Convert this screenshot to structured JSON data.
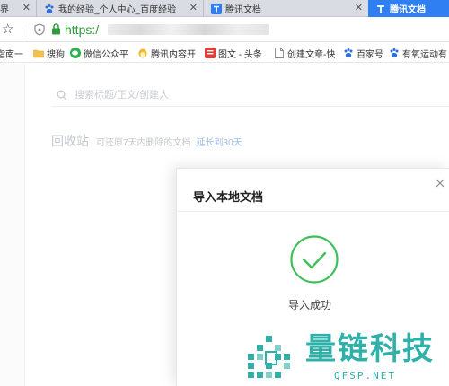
{
  "browser": {
    "tabs": [
      {
        "label": "界",
        "icon": "none",
        "close": "✕"
      },
      {
        "label": "我的经验_个人中心_百度经验",
        "icon": "baidu-paw-icon",
        "close": "✕"
      },
      {
        "label": "腾讯文档",
        "icon": "tencent-docs-icon",
        "close": "✕"
      },
      {
        "label": "腾讯文档",
        "icon": "tencent-docs-icon",
        "close": ""
      }
    ],
    "address": {
      "star": "☆",
      "url": "https:/"
    },
    "bookmarks": [
      {
        "label": "指南一",
        "icon": "none"
      },
      {
        "label": "搜狗",
        "icon": "folder-icon"
      },
      {
        "label": "微信公众平",
        "icon": "wechat-icon"
      },
      {
        "label": "腾讯内容开",
        "icon": "tencent-penguin-icon"
      },
      {
        "label": "图文 - 头条",
        "icon": "toutiao-icon"
      },
      {
        "label": "创建文章-快",
        "icon": "page-icon"
      },
      {
        "label": "百家号",
        "icon": "baidu-paw-icon"
      },
      {
        "label": "有氧运动有",
        "icon": "baidu-paw-icon"
      }
    ]
  },
  "page": {
    "search": {
      "placeholder": "搜索标题/正文/创建人"
    },
    "recycle": {
      "title": "回收站",
      "hint": "可还原7天内删除的文档",
      "link": "延长到30天"
    }
  },
  "dialog": {
    "title": "导入本地文档",
    "status": "导入成功",
    "close": "×"
  },
  "watermark": {
    "brand": "量链科技",
    "site": "QFSP.NET"
  },
  "colors": {
    "tab_active": "#2f7ff3",
    "url_green": "#2f9a3a",
    "success_green": "#3fbf5a",
    "link_blue": "#9dbbe8",
    "watermark_teal": "#2fb1aa"
  }
}
